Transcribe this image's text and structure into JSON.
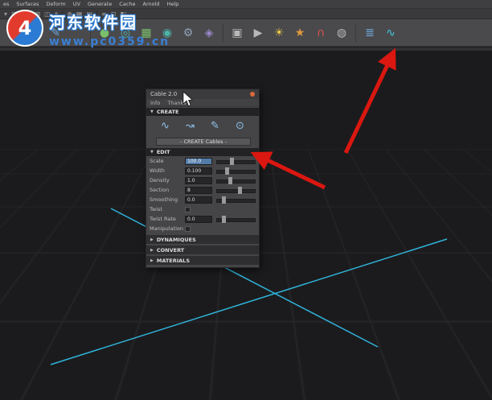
{
  "menubar": {
    "items": [
      "es",
      "Surfaces",
      "Deform",
      "UV",
      "Generate",
      "Cache",
      "Arnold",
      "Help"
    ]
  },
  "statusline": {
    "icons": [
      {
        "name": "menu-collapse-icon",
        "glyph": "▾"
      },
      {
        "name": "grid-display-icon",
        "glyph": "⊞"
      },
      {
        "name": "snap-grid-icon",
        "glyph": "⊟"
      },
      {
        "name": "snap-curve-icon",
        "glyph": "⊠"
      },
      {
        "name": "snap-point-icon",
        "glyph": "◫"
      },
      {
        "name": "snap-view-icon",
        "glyph": "⌖"
      },
      {
        "name": "snap-center-icon",
        "glyph": "⊕"
      },
      {
        "name": "construction-history-icon",
        "glyph": "▦"
      },
      {
        "name": "render-icon",
        "glyph": "▤"
      },
      {
        "name": "render-settings-icon",
        "glyph": "≡"
      },
      {
        "name": "display-layer-icon",
        "glyph": "⊡"
      },
      {
        "name": "anim-layer-icon",
        "glyph": "◧"
      }
    ]
  },
  "shelf": {
    "icons": [
      {
        "name": "curve-tool-icon",
        "glyph": "↷"
      },
      {
        "name": "ep-curve-icon",
        "glyph": "∿"
      },
      {
        "name": "pencil-curve-icon",
        "glyph": "✎"
      },
      {
        "name": "arc-tool-icon",
        "glyph": "⌒"
      },
      {
        "name": "sphere-icon",
        "glyph": "●"
      },
      {
        "name": "torus-icon",
        "glyph": "◎"
      },
      {
        "name": "plane-icon",
        "glyph": "▦"
      },
      {
        "name": "cylinder-icon",
        "glyph": "◉"
      },
      {
        "name": "gear-icon",
        "glyph": "⚙"
      },
      {
        "name": "prism-icon",
        "glyph": "◈"
      },
      {
        "name": "camera-icon",
        "glyph": "▣"
      },
      {
        "name": "playblast-icon",
        "glyph": "▶"
      },
      {
        "name": "point-light-icon",
        "glyph": "☀"
      },
      {
        "name": "sun-light-icon",
        "glyph": "★"
      },
      {
        "name": "magnet-icon",
        "glyph": "∩"
      },
      {
        "name": "snap-sphere-icon",
        "glyph": "◍"
      },
      {
        "name": "slider-panel-icon",
        "glyph": "≣"
      },
      {
        "name": "cable-plugin-icon",
        "glyph": "∿"
      }
    ]
  },
  "watermark": {
    "badge": "4",
    "site_name": "河东软件园",
    "url": "www.pc0359.cn"
  },
  "panel": {
    "title": "Cable 2.0",
    "menu": [
      "Info",
      "Thanks"
    ],
    "create_section": "CREATE",
    "edit_section": "EDIT",
    "create_button": "- CREATE Cables -",
    "tool_icons": [
      {
        "name": "cable-from-curve-icon",
        "glyph": "∿"
      },
      {
        "name": "cable-spline-icon",
        "glyph": "↝"
      },
      {
        "name": "cable-draw-icon",
        "glyph": "✎"
      },
      {
        "name": "cable-pin-icon",
        "glyph": "⊙"
      }
    ],
    "fields": [
      {
        "label": "Scale",
        "value": "100.0"
      },
      {
        "label": "Width",
        "value": "0.100"
      },
      {
        "label": "Density",
        "value": "1.0"
      },
      {
        "label": "Section",
        "value": "8"
      },
      {
        "label": "Smoothing",
        "value": "0.0"
      },
      {
        "label": "Twist",
        "value": ""
      },
      {
        "label": "Twist Rate",
        "value": "0.0"
      },
      {
        "label": "Manipulation",
        "value": ""
      }
    ],
    "collapsed": [
      {
        "label": "DYNAMIQUES"
      },
      {
        "label": "CONVERT"
      },
      {
        "label": "MATERIALS"
      }
    ]
  },
  "colors": {
    "arrow_red": "#da1710",
    "axis_cyan": "#2fb3d9",
    "selection_blue": "#527ba8"
  }
}
